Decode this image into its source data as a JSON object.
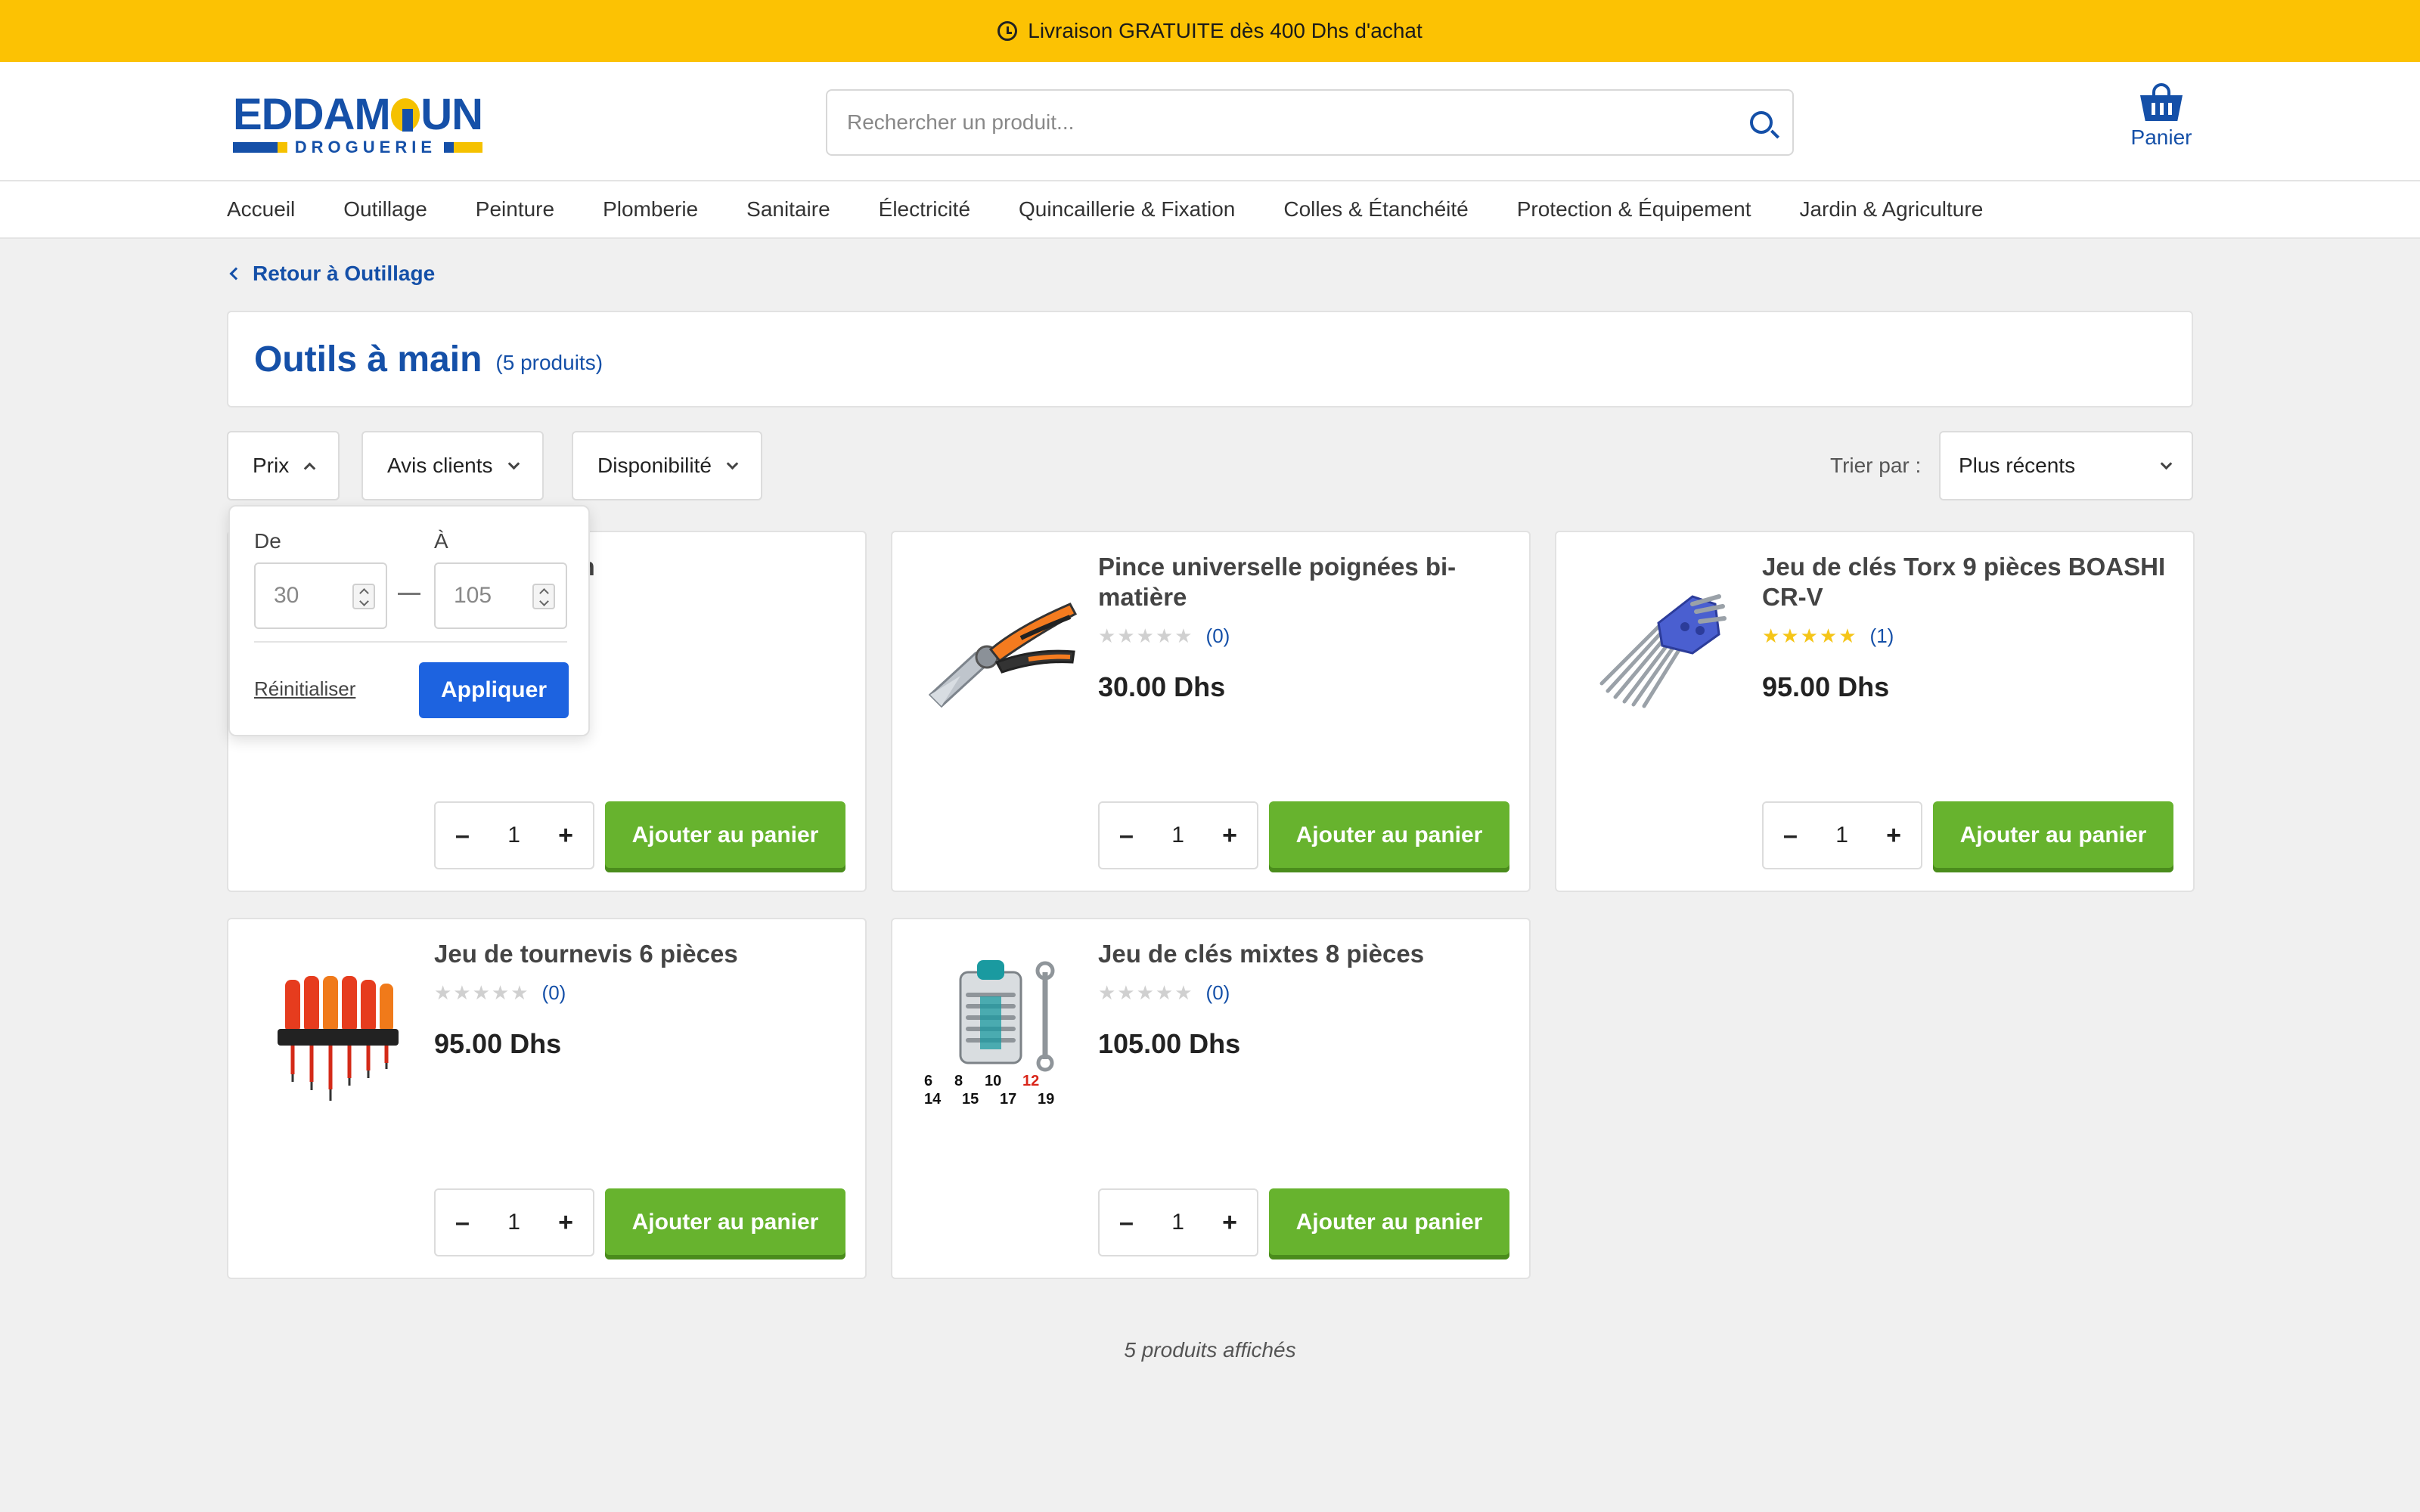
{
  "promo": {
    "text": "Livraison GRATUITE dès 400 Dhs d'achat",
    "icon": "clock-icon"
  },
  "brand": {
    "name_part1": "EDDAM",
    "name_part2": "UN",
    "tagline": "DROGUERIE",
    "primary_color": "#1550a8",
    "accent_color": "#f5c100"
  },
  "search": {
    "placeholder": "Rechercher un produit..."
  },
  "cart": {
    "label": "Panier"
  },
  "nav": [
    "Accueil",
    "Outillage",
    "Peinture",
    "Plomberie",
    "Sanitaire",
    "Électricité",
    "Quincaillerie & Fixation",
    "Colles & Étanchéité",
    "Protection & Équipement",
    "Jardin & Agriculture"
  ],
  "breadcrumb": {
    "back_label": "Retour à Outillage"
  },
  "category": {
    "title": "Outils à main",
    "count": "(5 produits)"
  },
  "filters": {
    "price": "Prix",
    "reviews": "Avis clients",
    "availability": "Disponibilité"
  },
  "sort": {
    "label": "Trier par :",
    "value": "Plus récents"
  },
  "price_filter": {
    "from_label": "De",
    "to_label": "À",
    "from_value": "30",
    "to_value": "105",
    "reset_label": "Réinitialiser",
    "apply_label": "Appliquer"
  },
  "products": [
    {
      "name": "…ain 240 mm",
      "stars": 0,
      "reviews": "",
      "price": "",
      "qty": "1",
      "add_label": "Ajouter au panier"
    },
    {
      "name": "Pince universelle poignées bi-matière",
      "stars": 0,
      "reviews": "(0)",
      "price": "30.00 Dhs",
      "qty": "1",
      "add_label": "Ajouter au panier"
    },
    {
      "name": "Jeu de clés Torx 9 pièces BOASHI CR-V",
      "stars": 5,
      "reviews": "(1)",
      "price": "95.00 Dhs",
      "qty": "1",
      "add_label": "Ajouter au panier"
    },
    {
      "name": "Jeu de tournevis 6 pièces",
      "stars": 0,
      "reviews": "(0)",
      "price": "95.00 Dhs",
      "qty": "1",
      "add_label": "Ajouter au panier"
    },
    {
      "name": "Jeu de clés mixtes 8 pièces",
      "stars": 0,
      "reviews": "(0)",
      "price": "105.00 Dhs",
      "qty": "1",
      "add_label": "Ajouter au panier"
    }
  ],
  "wrench_sizes": {
    "row1": [
      "6",
      "8",
      "10",
      "12"
    ],
    "row2": [
      "14",
      "15",
      "17",
      "19"
    ]
  },
  "footer": {
    "shown_count": "5 produits affichés"
  },
  "colors": {
    "promo_bg": "#fcc203",
    "add_button": "#67b32e",
    "apply_button": "#1d63e0",
    "star_filled": "#f5c518",
    "star_empty": "#d0d0d0"
  }
}
